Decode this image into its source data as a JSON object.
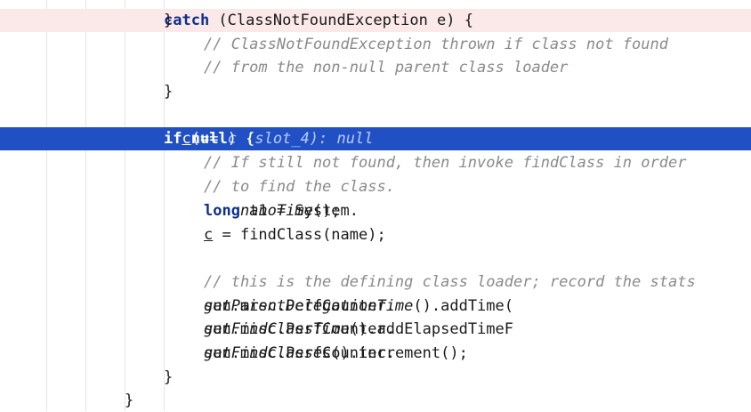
{
  "editor": {
    "lines": [
      {
        "tokens": [
          {
            "t": "} ",
            "c": "code"
          },
          {
            "t": "catch",
            "c": "kw"
          },
          {
            "t": " (ClassNotFoundException e) {",
            "c": "code"
          }
        ]
      },
      {
        "tokens": [
          {
            "t": "// ClassNotFoundException thrown if class not found",
            "c": "cm"
          }
        ]
      },
      {
        "tokens": [
          {
            "t": "// from the non-null parent class loader",
            "c": "cm"
          }
        ]
      },
      {
        "tokens": [
          {
            "t": "}",
            "c": "code"
          }
        ]
      },
      {
        "tokens": []
      },
      {
        "tokens": [
          {
            "t": "if",
            "c": "kw"
          },
          {
            "t": " (",
            "c": "code"
          },
          {
            "t": "c",
            "c": "ul"
          },
          {
            "t": " == ",
            "c": "code"
          },
          {
            "t": "null",
            "c": "kw"
          },
          {
            "t": ") {  ",
            "c": "code"
          },
          {
            "t": "c (slot_4): null",
            "c": "hint"
          }
        ]
      },
      {
        "tokens": [
          {
            "t": "// If still not found, then invoke findClass in order",
            "c": "cm"
          }
        ]
      },
      {
        "tokens": [
          {
            "t": "// to find the class.",
            "c": "cm"
          }
        ]
      },
      {
        "tokens": [
          {
            "t": "long",
            "c": "kw"
          },
          {
            "t": " t1 = System.",
            "c": "code"
          },
          {
            "t": "nanoTime",
            "c": "it"
          },
          {
            "t": "();",
            "c": "code"
          }
        ]
      },
      {
        "tokens": [
          {
            "t": "c",
            "c": "ul"
          },
          {
            "t": " = findClass(name);",
            "c": "code"
          }
        ]
      },
      {
        "tokens": []
      },
      {
        "tokens": [
          {
            "t": "// this is the defining class loader; record the stats",
            "c": "cm"
          }
        ]
      },
      {
        "tokens": [
          {
            "t": "sun.misc.PerfCounter.",
            "c": "code"
          },
          {
            "t": "getParentDelegationTime",
            "c": "it"
          },
          {
            "t": "().addTime(",
            "c": "code"
          }
        ]
      },
      {
        "tokens": [
          {
            "t": "sun.misc.PerfCounter.",
            "c": "code"
          },
          {
            "t": "getFindClassTime",
            "c": "it"
          },
          {
            "t": "().addElapsedTimeF",
            "c": "code"
          }
        ]
      },
      {
        "tokens": [
          {
            "t": "sun.misc.PerfCounter.",
            "c": "code"
          },
          {
            "t": "getFindClasses",
            "c": "it"
          },
          {
            "t": "().increment();",
            "c": "code"
          }
        ]
      },
      {
        "tokens": [
          {
            "t": "}",
            "c": "code"
          }
        ]
      },
      {
        "tokens": [
          {
            "t": "}",
            "c": "code"
          }
        ]
      }
    ]
  }
}
